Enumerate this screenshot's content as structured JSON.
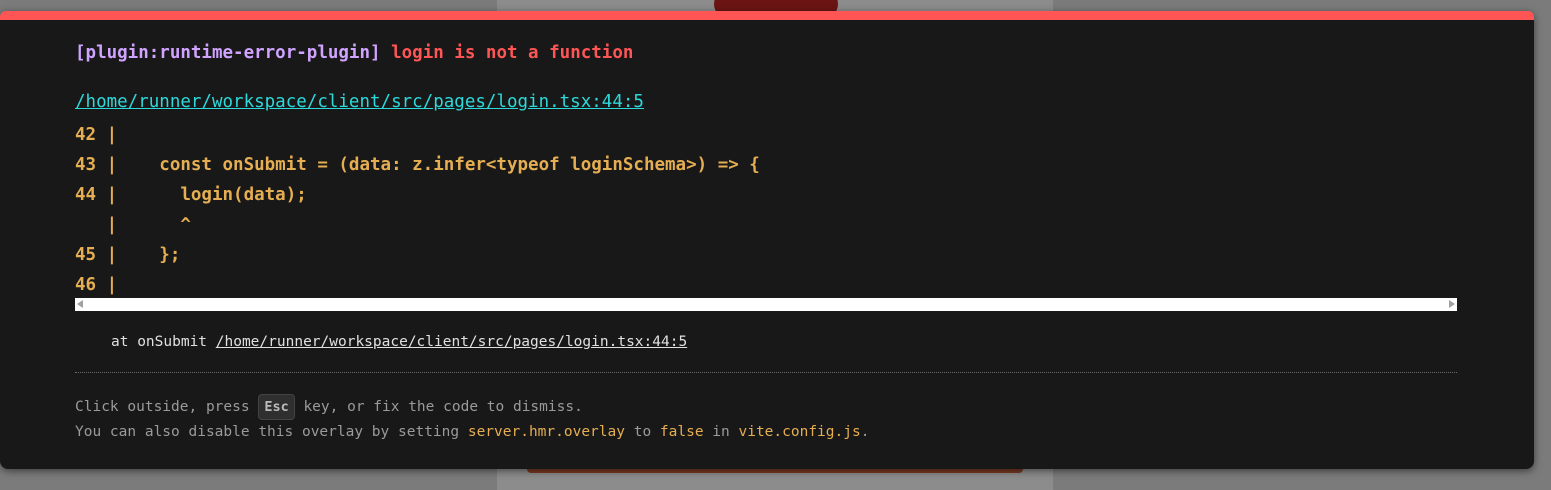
{
  "error": {
    "plugin": "[plugin:runtime-error-plugin]",
    "message": "login is not a function",
    "file": "/home/runner/workspace/client/src/pages/login.tsx:44:5"
  },
  "code_frame": [
    {
      "text": "42 |"
    },
    {
      "text": "43 |    const onSubmit = (data: z.infer<typeof loginSchema>) => {"
    },
    {
      "text": "44 |      login(data);"
    },
    {
      "text": "   |      ^"
    },
    {
      "text": "45 |    };"
    },
    {
      "text": "46 |"
    }
  ],
  "stack": {
    "prefix": "at onSubmit",
    "file": "/home/runner/workspace/client/src/pages/login.tsx:44:5"
  },
  "tips": {
    "line1_before": "Click outside, press ",
    "esc_key": "Esc",
    "line1_after": " key, or fix the code to dismiss.",
    "line2_before": "You can also disable this overlay by setting ",
    "setting": "server.hmr.overlay",
    "line2_mid1": " to ",
    "value": "false",
    "line2_mid2": " in ",
    "config_file": "vite.config.js",
    "line2_end": "."
  },
  "colors": {
    "accent_bar": "#ff5555",
    "plugin": "#cfa3ff",
    "error_message": "#ff5555",
    "file_link": "#2dd9da",
    "code": "#e6ae52",
    "background": "#181818"
  }
}
